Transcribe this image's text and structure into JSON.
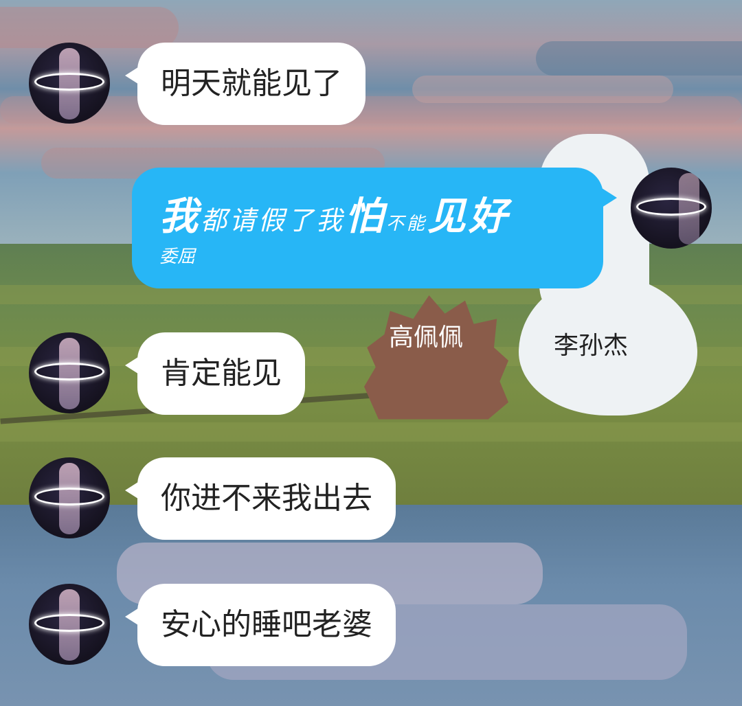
{
  "messages": [
    {
      "text": "明天就能见了",
      "direction": "received"
    },
    {
      "line1": [
        {
          "t": "我",
          "size": "big"
        },
        {
          "t": "都请假了",
          "size": "mid"
        },
        {
          "t": "我",
          "size": "mid"
        },
        {
          "t": "怕",
          "size": "big"
        },
        {
          "t": "不能",
          "size": "small"
        },
        {
          "t": "见",
          "size": "big"
        },
        {
          "t": "好",
          "size": "big"
        }
      ],
      "line2": "委屈",
      "direction": "sent"
    },
    {
      "text": "肯定能见",
      "direction": "received"
    },
    {
      "text": "你进不来我出去",
      "direction": "received"
    },
    {
      "text": "安心的睡吧老婆",
      "direction": "received"
    }
  ],
  "scene_labels": {
    "hedgehog": "高佩佩",
    "duck": "李孙杰"
  },
  "colors": {
    "sent_bubble": "#27b6f6",
    "received_bubble": "#ffffff"
  }
}
